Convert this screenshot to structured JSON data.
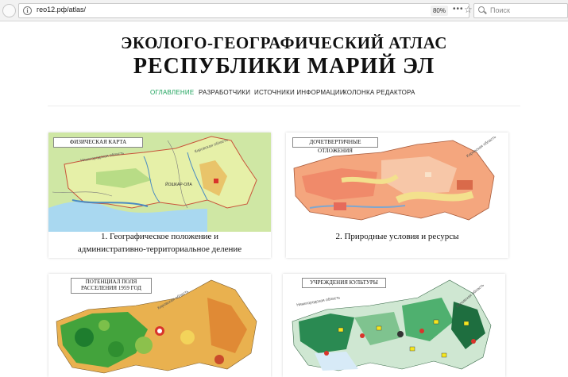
{
  "browser": {
    "url": "гео12.рф/atlas/",
    "zoom": "80%",
    "dots": "•••",
    "search_placeholder": "Поиск",
    "info_glyph": "i",
    "star_glyph": "☆"
  },
  "header": {
    "title_line1": "ЭКОЛОГО-ГЕОГРАФИЧЕСКИЙ АТЛАС",
    "title_line2": "РЕСПУБЛИКИ МАРИЙ ЭЛ"
  },
  "nav": [
    {
      "label": "ОГЛАВЛЕНИЕ",
      "active": true
    },
    {
      "label": "РАЗРАБОТЧИКИ",
      "active": false
    },
    {
      "label": "ИСТОЧНИКИ ИНФОРМАЦИИ",
      "active": false
    },
    {
      "label": "КОЛОНКА РЕДАКТОРА",
      "active": false
    }
  ],
  "cards": [
    {
      "map_label": "ФИЗИЧЕСКАЯ КАРТА",
      "caption_line1": "1. Географическое положение и",
      "caption_line2": "административно-территориальное деление"
    },
    {
      "map_label": "ДОЧЕТВЕРТИЧНЫЕ ОТЛОЖЕНИЯ",
      "caption_line1": "2. Природные условия и ресурсы",
      "caption_line2": ""
    },
    {
      "map_label_line1": "ПОТЕНЦИАЛ ПОЛЯ",
      "map_label_line2": "РАССЕЛЕНИЯ 1959 ГОД"
    },
    {
      "map_label": "УЧРЕЖДЕНИЯ КУЛЬТУРЫ"
    }
  ],
  "map_small_labels": {
    "kirov": "Кировская область",
    "nizhny": "Нижегородская область",
    "tatarstan": "Республика Татарстан",
    "capital": "ЙОШКАР-ОЛА"
  },
  "colors": {
    "accent": "#1ea35c",
    "physical_bg": "#cde8a0",
    "geology_bg": "#f4a77c",
    "potential_green": "#3fa53a",
    "potential_orange": "#e8a548",
    "culture_green": "#2d9a5a"
  }
}
